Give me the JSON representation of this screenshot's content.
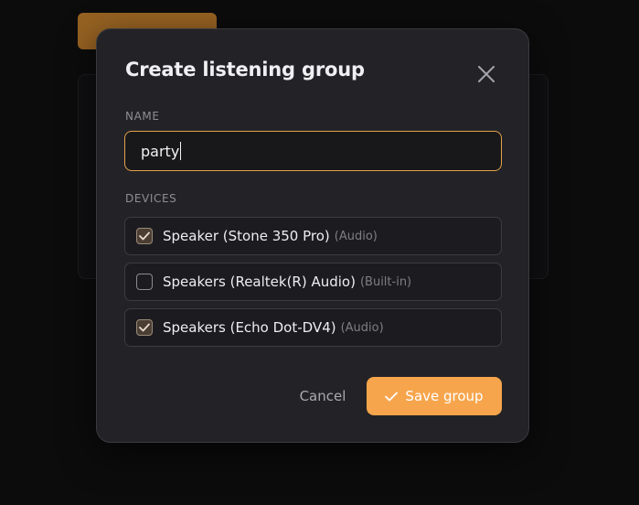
{
  "dialog": {
    "title": "Create listening group",
    "name_label": "NAME",
    "name_value": "party",
    "devices_label": "DEVICES",
    "devices": [
      {
        "name": "Speaker (Stone 350 Pro)",
        "type": "(Audio)",
        "checked": true
      },
      {
        "name": "Speakers (Realtek(R) Audio)",
        "type": "(Built-in)",
        "checked": false
      },
      {
        "name": "Speakers (Echo Dot-DV4)",
        "type": "(Audio)",
        "checked": true
      }
    ],
    "cancel_label": "Cancel",
    "save_label": "Save group",
    "close_icon": "close-icon",
    "save_icon": "check-icon"
  },
  "colors": {
    "accent": "#f7a54c",
    "dialog_bg": "#232327",
    "input_border": "#e5a04a"
  }
}
